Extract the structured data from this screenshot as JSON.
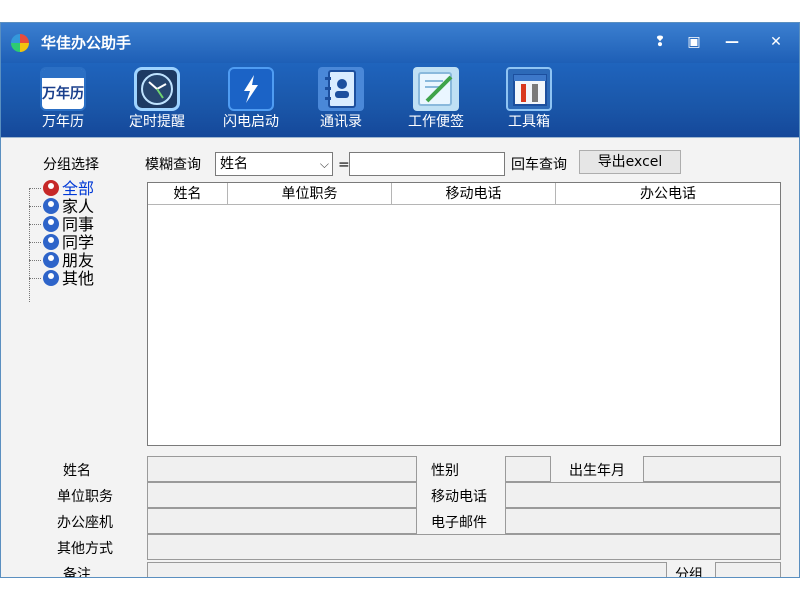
{
  "window": {
    "title": "华佳办公助手"
  },
  "title_controls": {
    "pin": "❢",
    "restore": "▣",
    "minimize": "—",
    "close": "✕"
  },
  "toolbar": {
    "calendar_icon_text": "万年历",
    "items": [
      {
        "label": "万年历",
        "icon": "calendar-icon"
      },
      {
        "label": "定时提醒",
        "icon": "clock-icon"
      },
      {
        "label": "闪电启动",
        "icon": "flash-icon"
      },
      {
        "label": "通讯录",
        "icon": "contacts-icon"
      },
      {
        "label": "工作便签",
        "icon": "notes-icon"
      },
      {
        "label": "工具箱",
        "icon": "toolbox-icon"
      }
    ]
  },
  "search": {
    "group_label": "分组选择",
    "fuzzy_label": "模糊查询",
    "field_selected": "姓名",
    "equals": "=",
    "query_value": "",
    "enter_query_label": "回车查询",
    "export_label": "导出excel"
  },
  "groups": {
    "items": [
      "全部",
      "家人",
      "同事",
      "同学",
      "朋友",
      "其他"
    ],
    "selected": "全部"
  },
  "grid": {
    "columns": [
      "姓名",
      "单位职务",
      "移动电话",
      "办公电话"
    ]
  },
  "detail": {
    "name_label": "姓名",
    "title_label": "单位职务",
    "office_phone_label": "办公座机",
    "other_contact_label": "其他方式",
    "remark_label": "备注",
    "gender_label": "性别",
    "birth_label": "出生年月",
    "mobile_label": "移动电话",
    "email_label": "电子邮件",
    "group_label": "分组"
  },
  "colors": {
    "titlebar": "#2a6fc8",
    "toolbar": "#1a56a8",
    "content_bg": "#f3f3f3",
    "selected_group": "#0039d6"
  }
}
